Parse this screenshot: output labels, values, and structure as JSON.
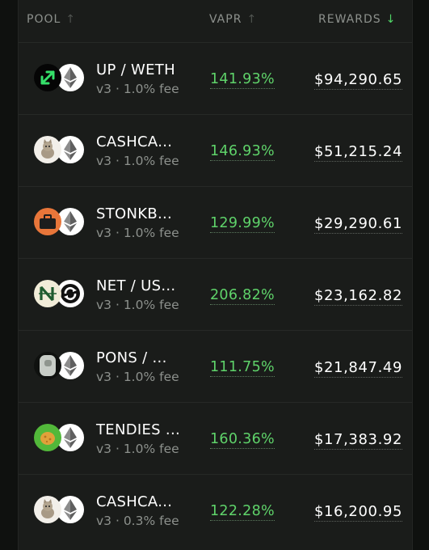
{
  "header": {
    "pool_label": "POOL",
    "vapr_label": "VAPR",
    "rewards_label": "REWARDS",
    "up_arrow": "↑",
    "down_arrow": "↓"
  },
  "colors": {
    "accent_green": "#5fd36a",
    "sort_active": "#4fd466"
  },
  "pools": [
    {
      "pair": "UP / WETH",
      "sub": "v3 · 1.0% fee",
      "vapr": "141.93%",
      "rewards": "$94,290.65",
      "token0_icon": "up-arrow-token-icon",
      "token1_icon": "eth-icon"
    },
    {
      "pair": "CASHCA...",
      "sub": "v3 · 1.0% fee",
      "vapr": "146.93%",
      "rewards": "$51,215.24",
      "token0_icon": "cat-token-icon",
      "token1_icon": "eth-icon"
    },
    {
      "pair": "STONKB...",
      "sub": "v3 · 1.0% fee",
      "vapr": "129.99%",
      "rewards": "$29,290.61",
      "token0_icon": "briefcase-token-icon",
      "token1_icon": "eth-icon"
    },
    {
      "pair": "NET / US...",
      "sub": "v3 · 1.0% fee",
      "vapr": "206.82%",
      "rewards": "$23,162.82",
      "token0_icon": "net-token-icon",
      "token1_icon": "refresh-token-icon"
    },
    {
      "pair": "PONS / ...",
      "sub": "v3 · 1.0% fee",
      "vapr": "111.75%",
      "rewards": "$21,847.49",
      "token0_icon": "pons-token-icon",
      "token1_icon": "eth-icon"
    },
    {
      "pair": "TENDIES ...",
      "sub": "v3 · 1.0% fee",
      "vapr": "160.36%",
      "rewards": "$17,383.92",
      "token0_icon": "nugget-token-icon",
      "token1_icon": "eth-icon"
    },
    {
      "pair": "CASHCA...",
      "sub": "v3 · 0.3% fee",
      "vapr": "122.28%",
      "rewards": "$16,200.95",
      "token0_icon": "cat-token-icon",
      "token1_icon": "eth-icon"
    }
  ]
}
